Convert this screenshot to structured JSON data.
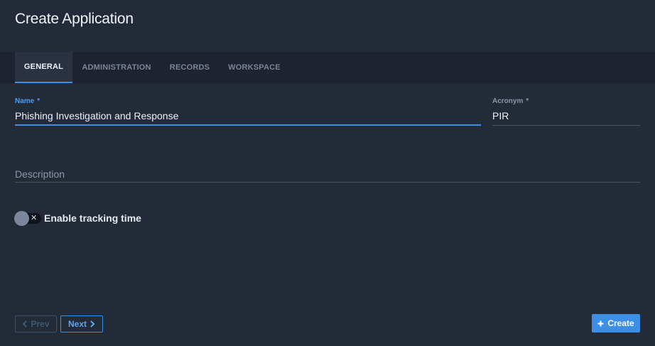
{
  "dialog": {
    "title": "Create Application"
  },
  "tabs": [
    {
      "label": "GENERAL",
      "active": true
    },
    {
      "label": "ADMINISTRATION",
      "active": false
    },
    {
      "label": "RECORDS",
      "active": false
    },
    {
      "label": "WORKSPACE",
      "active": false
    }
  ],
  "form": {
    "name": {
      "label": "Name",
      "required_marker": "*",
      "value": "Phishing Investigation and Response"
    },
    "acronym": {
      "label": "Acronym",
      "required_marker": "*",
      "value": "PIR"
    },
    "description": {
      "placeholder": "Description"
    },
    "tracking": {
      "label": "Enable tracking time",
      "enabled": false,
      "toggle_glyph": "✕"
    }
  },
  "footer": {
    "prev_label": "Prev",
    "next_label": "Next",
    "create_label": "Create",
    "prev_icon": "chevron-left-icon",
    "next_icon": "chevron-right-icon",
    "create_icon": "plus-icon"
  },
  "colors": {
    "background": "#232a38",
    "tabbar": "#1d2331",
    "accent": "#3d8fe6",
    "text": "#eef1f6",
    "muted": "#8e97a8"
  }
}
